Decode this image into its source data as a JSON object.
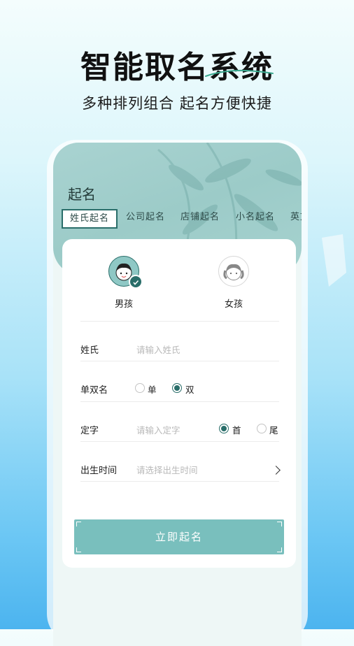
{
  "promo": {
    "headline": "智能取名系统",
    "subline": "多种排列组合 起名方便快捷"
  },
  "screen": {
    "title": "起名",
    "tabs": [
      "姓氏起名",
      "公司起名",
      "店铺起名",
      "小名起名",
      "英文起名"
    ],
    "active_tab": 0
  },
  "form": {
    "genders": [
      {
        "label": "男孩",
        "selected": true,
        "icon": "boy-avatar-icon"
      },
      {
        "label": "女孩",
        "selected": false,
        "icon": "girl-avatar-icon"
      }
    ],
    "surname": {
      "label": "姓氏",
      "placeholder": "请输入姓氏"
    },
    "name_length": {
      "label": "单双名",
      "options": [
        "单",
        "双"
      ],
      "selected": "双"
    },
    "fixed_char": {
      "label": "定字",
      "placeholder": "请输入定字",
      "options": [
        "首",
        "尾"
      ],
      "selected": "首"
    },
    "birth_time": {
      "label": "出生时间",
      "placeholder": "请选择出生时间",
      "icon": "chevron-right-icon"
    },
    "submit_label": "立即起名"
  },
  "colors": {
    "accent": "#2a6e6a",
    "header_bg": "#a3cfcc",
    "button_bg": "#79bfbd",
    "page_gradient_bottom": "#4cb4ef"
  }
}
